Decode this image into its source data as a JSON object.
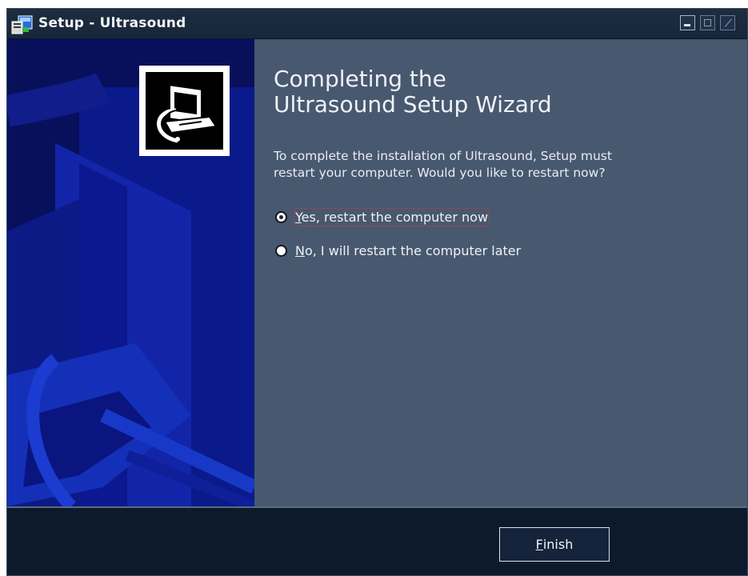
{
  "window": {
    "title": "Setup - Ultrasound"
  },
  "icons": {
    "app": "setup-app-icon",
    "logo": "computer-install-icon",
    "minimize": "minimize-icon",
    "maximize": "maximize-icon",
    "close": "close-icon"
  },
  "content": {
    "heading": "Completing the\nUltrasound Setup Wizard",
    "description": "To complete the installation of Ultrasound, Setup must\nrestart your computer. Would you like to restart now?",
    "options": [
      {
        "label": "Yes, restart the computer now",
        "accel": "Y",
        "rest": "es, restart the computer now",
        "selected": true
      },
      {
        "label": "No, I will restart the computer later",
        "accel": "N",
        "rest": "o, I will restart the computer later",
        "selected": false
      }
    ]
  },
  "buttons": {
    "finish": {
      "label": "Finish",
      "accel": "F",
      "rest": "inish"
    }
  },
  "colors": {
    "content_bg": "#48586f",
    "left_panel_bg": "#0a1066",
    "bottom_bg": "#0d1a2b",
    "titlebar_bg": "#1a2a3e"
  }
}
